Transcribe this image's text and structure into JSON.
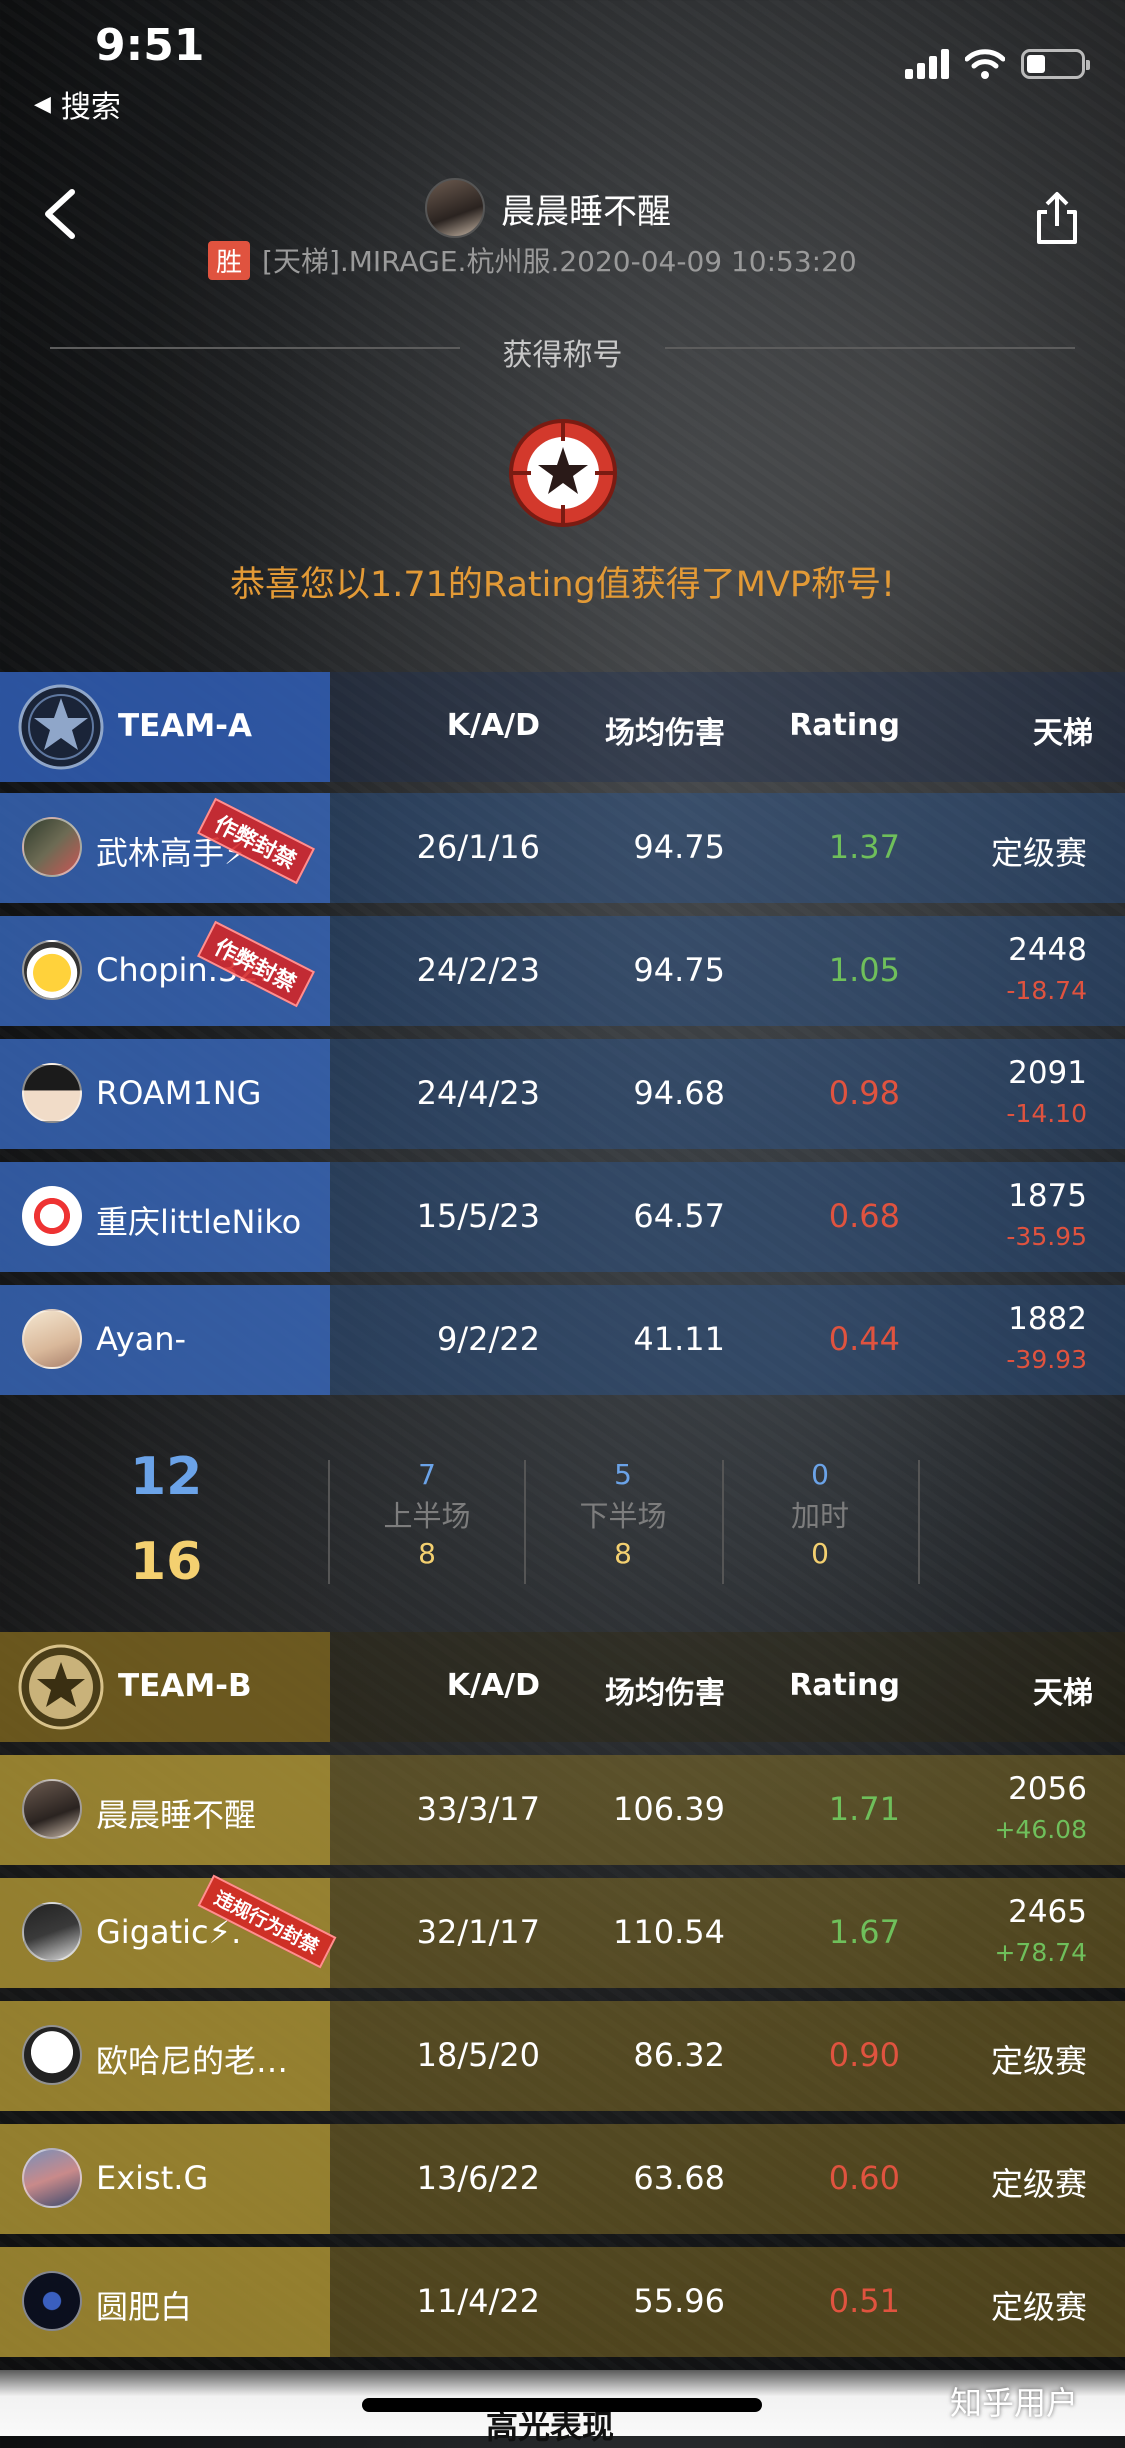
{
  "status_bar": {
    "time": "9:51",
    "back_label": "搜索"
  },
  "header": {
    "user_name": "晨晨睡不醒",
    "result_badge": "胜",
    "match_info": "[天梯].MIRAGE.杭州服.2020-04-09 10:53:20"
  },
  "title_section": {
    "label": "获得称号",
    "mvp_message": "恭喜您以1.71的Rating值获得了MVP称号!"
  },
  "columns": {
    "kad": "K/A/D",
    "damage": "场均伤害",
    "rating": "Rating",
    "ladder": "天梯"
  },
  "team_a": {
    "name": "TEAM-A",
    "players": [
      {
        "name": "武林高手⚡",
        "kad": "26/1/16",
        "damage": "94.75",
        "rating": "1.37",
        "rating_status": "good",
        "ladder": "定级赛",
        "ladder_delta": "",
        "stamp": "作弊封禁"
      },
      {
        "name": "Chopin.32.",
        "kad": "24/2/23",
        "damage": "94.75",
        "rating": "1.05",
        "rating_status": "good",
        "ladder": "2448",
        "ladder_delta": "-18.74",
        "stamp": "作弊封禁"
      },
      {
        "name": "ROAM1NG",
        "kad": "24/4/23",
        "damage": "94.68",
        "rating": "0.98",
        "rating_status": "bad",
        "ladder": "2091",
        "ladder_delta": "-14.10",
        "stamp": ""
      },
      {
        "name": "重庆littleNiko",
        "kad": "15/5/23",
        "damage": "64.57",
        "rating": "0.68",
        "rating_status": "bad",
        "ladder": "1875",
        "ladder_delta": "-35.95",
        "stamp": ""
      },
      {
        "name": "Ayan-",
        "kad": "9/2/22",
        "damage": "41.11",
        "rating": "0.44",
        "rating_status": "bad",
        "ladder": "1882",
        "ladder_delta": "-39.93",
        "stamp": ""
      }
    ]
  },
  "score": {
    "team_a_total": "12",
    "team_b_total": "16",
    "halves": [
      {
        "label": "上半场",
        "a": "7",
        "b": "8"
      },
      {
        "label": "下半场",
        "a": "5",
        "b": "8"
      },
      {
        "label": "加时",
        "a": "0",
        "b": "0"
      }
    ]
  },
  "team_b": {
    "name": "TEAM-B",
    "players": [
      {
        "name": "晨晨睡不醒",
        "kad": "33/3/17",
        "damage": "106.39",
        "rating": "1.71",
        "rating_status": "good",
        "ladder": "2056",
        "ladder_delta": "+46.08",
        "stamp": ""
      },
      {
        "name": "Gigatic⚡.",
        "kad": "32/1/17",
        "damage": "110.54",
        "rating": "1.67",
        "rating_status": "good",
        "ladder": "2465",
        "ladder_delta": "+78.74",
        "stamp": "违规行为封禁"
      },
      {
        "name": "欧哈尼的老…",
        "kad": "18/5/20",
        "damage": "86.32",
        "rating": "0.90",
        "rating_status": "bad",
        "ladder": "定级赛",
        "ladder_delta": "",
        "stamp": ""
      },
      {
        "name": "Exist.G",
        "kad": "13/6/22",
        "damage": "63.68",
        "rating": "0.60",
        "rating_status": "bad",
        "ladder": "定级赛",
        "ladder_delta": "",
        "stamp": ""
      },
      {
        "name": "圆肥白",
        "kad": "11/4/22",
        "damage": "55.96",
        "rating": "0.51",
        "rating_status": "bad",
        "ladder": "定级赛",
        "ladder_delta": "",
        "stamp": ""
      }
    ]
  },
  "footer": {
    "section_title": "高光表现",
    "watermark": "知乎用户"
  },
  "colors": {
    "good": "#6fbf5b",
    "bad": "#e0533f",
    "team_a": "#305cb2",
    "team_b": "#b09634",
    "mvp": "#e39a36"
  }
}
